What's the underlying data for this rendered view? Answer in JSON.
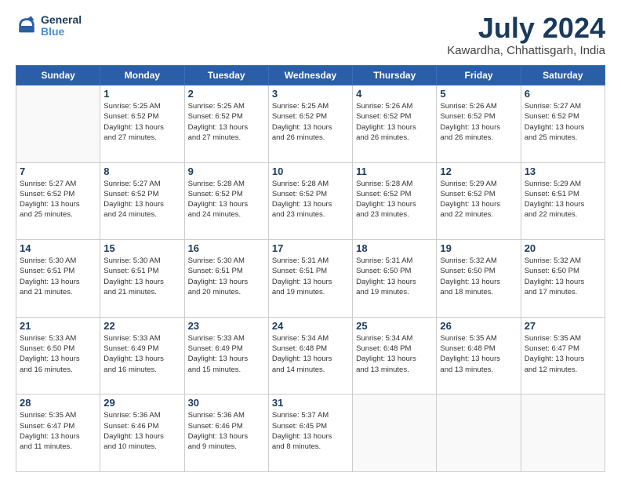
{
  "header": {
    "logo_line1": "General",
    "logo_line2": "Blue",
    "month": "July 2024",
    "location": "Kawardha, Chhattisgarh, India"
  },
  "days_of_week": [
    "Sunday",
    "Monday",
    "Tuesday",
    "Wednesday",
    "Thursday",
    "Friday",
    "Saturday"
  ],
  "weeks": [
    [
      {
        "day": "",
        "content": ""
      },
      {
        "day": "1",
        "content": "Sunrise: 5:25 AM\nSunset: 6:52 PM\nDaylight: 13 hours\nand 27 minutes."
      },
      {
        "day": "2",
        "content": "Sunrise: 5:25 AM\nSunset: 6:52 PM\nDaylight: 13 hours\nand 27 minutes."
      },
      {
        "day": "3",
        "content": "Sunrise: 5:25 AM\nSunset: 6:52 PM\nDaylight: 13 hours\nand 26 minutes."
      },
      {
        "day": "4",
        "content": "Sunrise: 5:26 AM\nSunset: 6:52 PM\nDaylight: 13 hours\nand 26 minutes."
      },
      {
        "day": "5",
        "content": "Sunrise: 5:26 AM\nSunset: 6:52 PM\nDaylight: 13 hours\nand 26 minutes."
      },
      {
        "day": "6",
        "content": "Sunrise: 5:27 AM\nSunset: 6:52 PM\nDaylight: 13 hours\nand 25 minutes."
      }
    ],
    [
      {
        "day": "7",
        "content": "Sunrise: 5:27 AM\nSunset: 6:52 PM\nDaylight: 13 hours\nand 25 minutes."
      },
      {
        "day": "8",
        "content": "Sunrise: 5:27 AM\nSunset: 6:52 PM\nDaylight: 13 hours\nand 24 minutes."
      },
      {
        "day": "9",
        "content": "Sunrise: 5:28 AM\nSunset: 6:52 PM\nDaylight: 13 hours\nand 24 minutes."
      },
      {
        "day": "10",
        "content": "Sunrise: 5:28 AM\nSunset: 6:52 PM\nDaylight: 13 hours\nand 23 minutes."
      },
      {
        "day": "11",
        "content": "Sunrise: 5:28 AM\nSunset: 6:52 PM\nDaylight: 13 hours\nand 23 minutes."
      },
      {
        "day": "12",
        "content": "Sunrise: 5:29 AM\nSunset: 6:52 PM\nDaylight: 13 hours\nand 22 minutes."
      },
      {
        "day": "13",
        "content": "Sunrise: 5:29 AM\nSunset: 6:51 PM\nDaylight: 13 hours\nand 22 minutes."
      }
    ],
    [
      {
        "day": "14",
        "content": "Sunrise: 5:30 AM\nSunset: 6:51 PM\nDaylight: 13 hours\nand 21 minutes."
      },
      {
        "day": "15",
        "content": "Sunrise: 5:30 AM\nSunset: 6:51 PM\nDaylight: 13 hours\nand 21 minutes."
      },
      {
        "day": "16",
        "content": "Sunrise: 5:30 AM\nSunset: 6:51 PM\nDaylight: 13 hours\nand 20 minutes."
      },
      {
        "day": "17",
        "content": "Sunrise: 5:31 AM\nSunset: 6:51 PM\nDaylight: 13 hours\nand 19 minutes."
      },
      {
        "day": "18",
        "content": "Sunrise: 5:31 AM\nSunset: 6:50 PM\nDaylight: 13 hours\nand 19 minutes."
      },
      {
        "day": "19",
        "content": "Sunrise: 5:32 AM\nSunset: 6:50 PM\nDaylight: 13 hours\nand 18 minutes."
      },
      {
        "day": "20",
        "content": "Sunrise: 5:32 AM\nSunset: 6:50 PM\nDaylight: 13 hours\nand 17 minutes."
      }
    ],
    [
      {
        "day": "21",
        "content": "Sunrise: 5:33 AM\nSunset: 6:50 PM\nDaylight: 13 hours\nand 16 minutes."
      },
      {
        "day": "22",
        "content": "Sunrise: 5:33 AM\nSunset: 6:49 PM\nDaylight: 13 hours\nand 16 minutes."
      },
      {
        "day": "23",
        "content": "Sunrise: 5:33 AM\nSunset: 6:49 PM\nDaylight: 13 hours\nand 15 minutes."
      },
      {
        "day": "24",
        "content": "Sunrise: 5:34 AM\nSunset: 6:48 PM\nDaylight: 13 hours\nand 14 minutes."
      },
      {
        "day": "25",
        "content": "Sunrise: 5:34 AM\nSunset: 6:48 PM\nDaylight: 13 hours\nand 13 minutes."
      },
      {
        "day": "26",
        "content": "Sunrise: 5:35 AM\nSunset: 6:48 PM\nDaylight: 13 hours\nand 13 minutes."
      },
      {
        "day": "27",
        "content": "Sunrise: 5:35 AM\nSunset: 6:47 PM\nDaylight: 13 hours\nand 12 minutes."
      }
    ],
    [
      {
        "day": "28",
        "content": "Sunrise: 5:35 AM\nSunset: 6:47 PM\nDaylight: 13 hours\nand 11 minutes."
      },
      {
        "day": "29",
        "content": "Sunrise: 5:36 AM\nSunset: 6:46 PM\nDaylight: 13 hours\nand 10 minutes."
      },
      {
        "day": "30",
        "content": "Sunrise: 5:36 AM\nSunset: 6:46 PM\nDaylight: 13 hours\nand 9 minutes."
      },
      {
        "day": "31",
        "content": "Sunrise: 5:37 AM\nSunset: 6:45 PM\nDaylight: 13 hours\nand 8 minutes."
      },
      {
        "day": "",
        "content": ""
      },
      {
        "day": "",
        "content": ""
      },
      {
        "day": "",
        "content": ""
      }
    ]
  ]
}
